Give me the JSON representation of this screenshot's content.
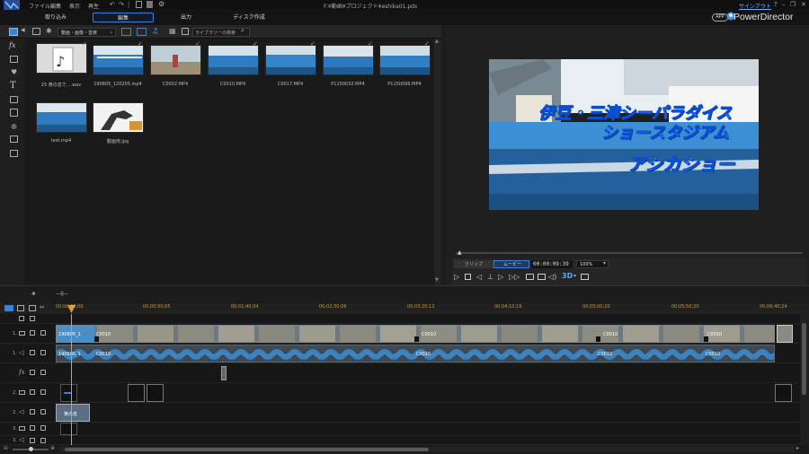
{
  "menu": {
    "items": [
      "ファイル",
      "編集",
      "表示",
      "再生"
    ],
    "file_path": "F:¥動画¥プロジェクト¥eshika01.pds",
    "sign_out": "サインアウト",
    "help": "?",
    "minimize": "–",
    "restore": "❐",
    "close": "✕"
  },
  "tabs": [
    {
      "label": "取り込み",
      "active": false
    },
    {
      "label": "編集",
      "active": true
    },
    {
      "label": "出力",
      "active": false
    },
    {
      "label": "ディスク作成",
      "active": false
    }
  ],
  "brand": {
    "app_badge": "APP",
    "name": "PowerDirector"
  },
  "library": {
    "filter": "動画・画像・音楽",
    "search_placeholder": "ライブラリーの検索",
    "items": [
      {
        "label": "25 黄の息で....wav",
        "kind": "audio",
        "used": true
      },
      {
        "label": "190805_120205.mp4",
        "kind": "video",
        "used": true
      },
      {
        "label": "C0002.MP4",
        "kind": "video",
        "used": true
      },
      {
        "label": "C0010.MP4",
        "kind": "video",
        "used": true
      },
      {
        "label": "C0017.MP4",
        "kind": "video",
        "used": true
      },
      {
        "label": "P1150032.MP4",
        "kind": "video",
        "used": true
      },
      {
        "label": "P1150099.MP4",
        "kind": "video",
        "used": true
      },
      {
        "label": "test.mp4",
        "kind": "video",
        "used": false
      },
      {
        "label": "動画用.jpg",
        "kind": "image",
        "used": false
      }
    ]
  },
  "preview": {
    "title_line1": "伊豆・三津シーパラダイス",
    "title_line2": "ショースタジアム",
    "title_line3": "アシカショー",
    "mode_clip": "クリップ",
    "mode_movie": "ムービー",
    "timecode": "00:00:09:39",
    "zoom": "100%",
    "three_d": "3D"
  },
  "timeline": {
    "ruler_ticks": [
      "00;00;00;00",
      "00;00;50;05",
      "00;01;40;04",
      "00;02;30;06",
      "00;03;20;12",
      "00;04;10;16",
      "00;05;00;20",
      "00;05;50;20",
      "00;06;40;24"
    ],
    "tracks": [
      {
        "label": "1.",
        "type": "video"
      },
      {
        "label": "1.",
        "type": "audio"
      },
      {
        "label": "fx",
        "type": "effect"
      },
      {
        "label": "2.",
        "type": "video"
      },
      {
        "label": "2.",
        "type": "audio"
      },
      {
        "label": "3.",
        "type": "video"
      },
      {
        "label": "3.",
        "type": "audio"
      }
    ],
    "clip_main_label": "190805_1",
    "clip_segments": [
      "C0010",
      "C0010",
      "C0010",
      "C0010"
    ],
    "audio_main_label": "190805_1",
    "audio_segments": [
      "C0010",
      "C0010",
      "C0010",
      "C0010"
    ],
    "title_clip_label": "黄の息"
  },
  "colors": {
    "accent": "#3a82d4",
    "playhead": "#e0a030",
    "clip_bg": "#5e6a74",
    "audio_wave": "#2e7bbf",
    "check": "#58d06a"
  }
}
